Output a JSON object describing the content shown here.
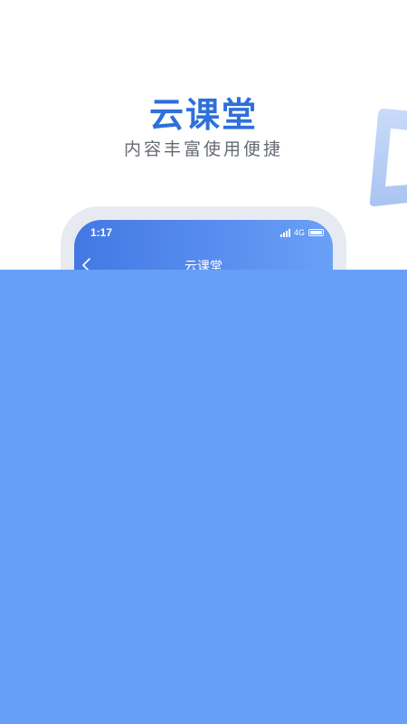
{
  "hero": {
    "title": "云课堂",
    "subtitle": "内容丰富使用便捷"
  },
  "phone": {
    "status_bar": {
      "time": "1:17",
      "network": "4G",
      "icons": [
        "signal-icon",
        "battery-icon"
      ]
    },
    "nav_bar": {
      "back_icon": "chevron-left-icon",
      "title": "云课堂"
    }
  },
  "colors": {
    "accent": "#2f6fdb",
    "subtitle": "#666a72",
    "phone_frame": "#e7ebf1",
    "header_gradient_start": "#4378e3",
    "header_gradient_end": "#6aa0f6",
    "overlay_panel": "#679ff7",
    "decoration": "#b9d0f5"
  }
}
